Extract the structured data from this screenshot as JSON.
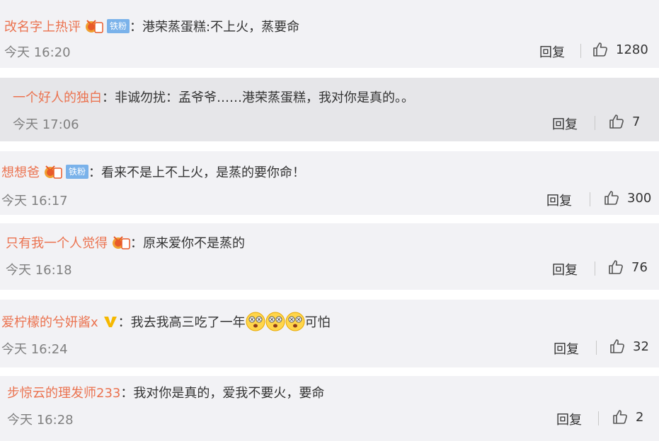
{
  "comments": [
    {
      "user": "改名字上热评",
      "has_medal": true,
      "fan_badge": "铁粉",
      "text": "港荣蒸蛋糕:不上火，蒸要命",
      "time": "今天 16:20",
      "reply_label": "回复",
      "likes": "1280"
    },
    {
      "user": "一个好人的独白",
      "has_medal": false,
      "text": "非诚勿扰：孟爷爷……港荣蒸蛋糕，我对你是真的。。",
      "time": "今天 17:06",
      "reply_label": "回复",
      "likes": "7"
    },
    {
      "user": "想想爸",
      "has_medal": true,
      "fan_badge": "铁粉",
      "text": "看来不是上不上火，是蒸的要你命！",
      "time": "今天 16:17",
      "reply_label": "回复",
      "likes": "300"
    },
    {
      "user": "只有我一个人觉得",
      "has_medal": true,
      "text": "原来爱你不是蒸的",
      "time": "今天 16:18",
      "reply_label": "回复",
      "likes": "76"
    },
    {
      "user": "爱柠檬的兮妍酱x",
      "verified_badge": "V",
      "text_before": "我去我高三吃了一年",
      "text_after": "可怕",
      "emoji_count": 3,
      "time": "今天 16:24",
      "reply_label": "回复",
      "likes": "32"
    },
    {
      "user": "步惊云的理发师233",
      "text": "我对你是真的，爱我不要火，要命",
      "time": "今天 16:28",
      "reply_label": "回复",
      "likes": "2"
    }
  ],
  "colors": {
    "username": "#eb7350",
    "card_bg": "#f2f2f5",
    "reply_card_bg": "#e6e6e9",
    "fan_badge_bg": "#7ab2ea",
    "time": "#808080"
  },
  "icons": {
    "like": "thumbs-up-icon",
    "medal": "medal-icon",
    "verified": "verified-v-icon",
    "emoji": "dizzy-face-emoji"
  }
}
